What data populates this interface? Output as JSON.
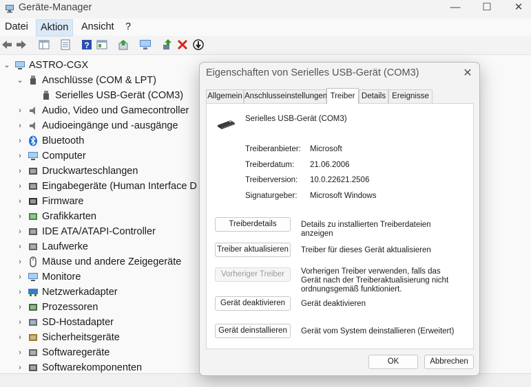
{
  "window": {
    "title": "Geräte-Manager",
    "minimize": "—",
    "maximize": "☐",
    "close": "✕"
  },
  "menu": [
    "Datei",
    "Aktion",
    "Ansicht",
    "?"
  ],
  "toolbar": {
    "icons": [
      "back-arrow-icon",
      "forward-arrow-icon",
      "properties-grid-icon",
      "list-view-icon",
      "help-icon",
      "console-icon",
      "update-driver-icon",
      "monitor-scan-icon",
      "enable-device-icon",
      "uninstall-device-icon",
      "disable-device-icon"
    ]
  },
  "tree": {
    "root": "ASTRO-CGX",
    "items": [
      {
        "label": "Anschlüsse (COM & LPT)",
        "expanded": true,
        "icon": "port-icon"
      },
      {
        "label": "Serielles USB-Gerät (COM3)",
        "child": true,
        "icon": "port-icon"
      },
      {
        "label": "Audio, Video und Gamecontroller",
        "icon": "speaker-icon"
      },
      {
        "label": "Audioeingänge und -ausgänge",
        "icon": "speaker-icon"
      },
      {
        "label": "Bluetooth",
        "icon": "bluetooth-icon"
      },
      {
        "label": "Computer",
        "icon": "computer-icon"
      },
      {
        "label": "Druckwarteschlangen",
        "icon": "printer-icon"
      },
      {
        "label": "Eingabegeräte (Human Interface D",
        "icon": "keyboard-icon"
      },
      {
        "label": "Firmware",
        "icon": "chip-icon"
      },
      {
        "label": "Grafikkarten",
        "icon": "display-adapter-icon"
      },
      {
        "label": "IDE ATA/ATAPI-Controller",
        "icon": "controller-icon"
      },
      {
        "label": "Laufwerke",
        "icon": "drive-icon"
      },
      {
        "label": "Mäuse und andere Zeigegeräte",
        "icon": "mouse-icon"
      },
      {
        "label": "Monitore",
        "icon": "monitor-icon"
      },
      {
        "label": "Netzwerkadapter",
        "icon": "network-icon"
      },
      {
        "label": "Prozessoren",
        "icon": "processor-icon"
      },
      {
        "label": "SD-Hostadapter",
        "icon": "sd-card-icon"
      },
      {
        "label": "Sicherheitsgeräte",
        "icon": "security-key-icon"
      },
      {
        "label": "Softwaregeräte",
        "icon": "software-device-icon"
      },
      {
        "label": "Softwarekomponenten",
        "icon": "software-component-icon"
      }
    ]
  },
  "dialog": {
    "title": "Eigenschaften von Serielles USB-Gerät (COM3)",
    "close": "✕",
    "tabs": [
      "Allgemein",
      "Anschlusseinstellungen",
      "Treiber",
      "Details",
      "Ereignisse"
    ],
    "selected_tab": "Treiber",
    "device_name": "Serielles USB-Gerät (COM3)",
    "info": [
      {
        "label": "Treiberanbieter:",
        "value": "Microsoft"
      },
      {
        "label": "Treiberdatum:",
        "value": "21.06.2006"
      },
      {
        "label": "Treiberversion:",
        "value": "10.0.22621.2506"
      },
      {
        "label": "Signaturgeber:",
        "value": "Microsoft Windows"
      }
    ],
    "actions": [
      {
        "button": "Treiberdetails",
        "desc": "Details zu installierten Treiberdateien anzeigen",
        "enabled": true
      },
      {
        "button": "Treiber aktualisieren",
        "desc": "Treiber für dieses Gerät aktualisieren",
        "enabled": true
      },
      {
        "button": "Vorheriger Treiber",
        "desc": "Vorherigen Treiber verwenden, falls das Gerät nach der Treiberaktualisierung nicht ordnungsgemäß funktioniert.",
        "enabled": false
      },
      {
        "button": "Gerät deaktivieren",
        "desc": "Gerät deaktivieren",
        "enabled": true
      },
      {
        "button": "Gerät deinstallieren",
        "desc": "Gerät vom System deinstallieren (Erweitert)",
        "enabled": true
      }
    ],
    "ok": "OK",
    "cancel": "Abbrechen"
  }
}
